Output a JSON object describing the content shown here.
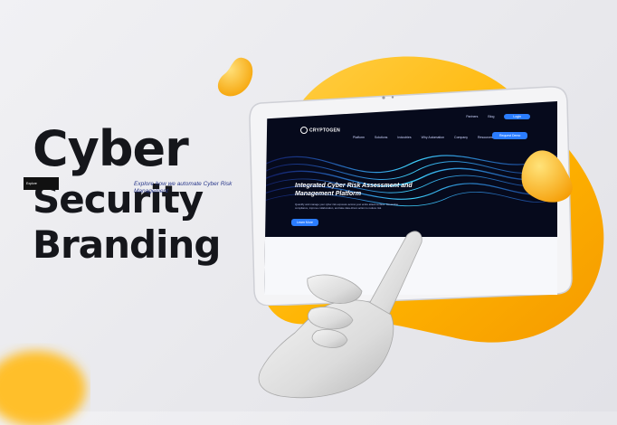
{
  "headline": {
    "line1": "Cyber",
    "line2": "Security",
    "line3": "Branding"
  },
  "website": {
    "logo": "CRYPTOGEN",
    "top_nav": [
      "Partners",
      "Blog",
      "Login"
    ],
    "menu": [
      "Platform",
      "Solutions",
      "Industries",
      "Why Automation",
      "Company",
      "Resources"
    ],
    "cta": "Request Demo",
    "hero_title": "Integrated Cyber Risk Assessment and Management Platform",
    "hero_body": "Quantify and manage your cyber risk exposure across your entire attack surface. Streamline compliance, improve collaboration, and take data-driven action to reduce risk.",
    "hero_button": "Learn More",
    "lower_button": "Explore",
    "lower_text": "Explore how we automate Cyber Risk Management"
  },
  "colors": {
    "accent_yellow": "#ffb400",
    "site_blue": "#2b7dff",
    "headline": "#15161b"
  }
}
